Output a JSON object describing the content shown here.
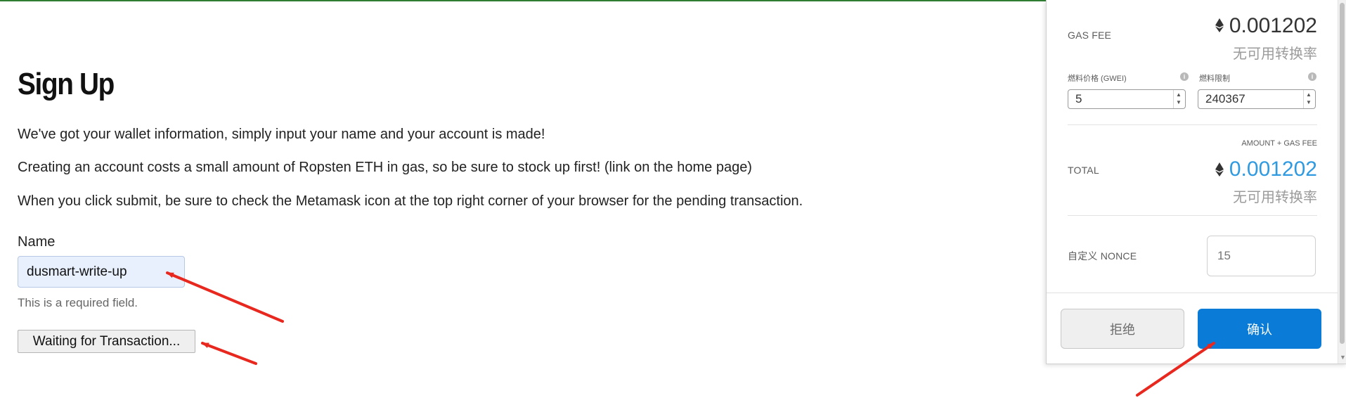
{
  "page": {
    "title": "Sign Up",
    "paragraphs": [
      "We've got your wallet information, simply input your name and your account is made!",
      "Creating an account costs a small amount of Ropsten ETH in gas, so be sure to stock up first! (link on the home page)",
      "When you click submit, be sure to check the Metamask icon at the top right corner of your browser for the pending transaction."
    ],
    "name_label": "Name",
    "name_value": "dusmart-write-up",
    "helper_text": "This is a required field.",
    "submit_label": "Waiting for Transaction..."
  },
  "metamask": {
    "gas_fee_label": "GAS FEE",
    "gas_fee_amount": "0.001202",
    "gas_fee_conversion": "无可用转换率",
    "gas_price_label": "燃料价格 (GWEI)",
    "gas_price_value": "5",
    "gas_limit_label": "燃料限制",
    "gas_limit_value": "240367",
    "amount_gas_fee_label": "AMOUNT + GAS FEE",
    "total_label": "TOTAL",
    "total_amount": "0.001202",
    "total_conversion": "无可用转换率",
    "nonce_label": "自定义 NONCE",
    "nonce_placeholder": "15",
    "reject_label": "拒绝",
    "confirm_label": "确认"
  },
  "icons": {
    "eth": "ethereum-diamond-icon",
    "info": "info-icon",
    "annotation": "red-arrow"
  },
  "colors": {
    "total_accent": "#2f9ae0",
    "confirm_button": "#0a7bd6",
    "annotation_arrow": "#e8281e",
    "name_input_bg": "#e8f0fe"
  }
}
